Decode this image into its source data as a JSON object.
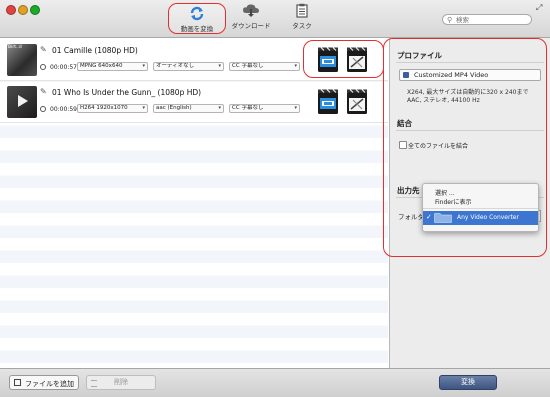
{
  "toolbar": {
    "convert_label": "動画を変換",
    "download_label": "ダウンロード",
    "task_label": "タスク",
    "search_placeholder": "検索"
  },
  "files": [
    {
      "name": "01 Camille (1080p HD)",
      "thumb_label": "Birt..d",
      "duration": "00:00:57",
      "video": "MPNG 640x640",
      "audio": "オーディオなし",
      "subtitle": "字幕なし"
    },
    {
      "name": "01 Who Is Under the Gunn_ (1080p HD)",
      "thumb_label": "",
      "duration": "00:00:59",
      "video": "H264 1920x1070",
      "audio": "aac (English)",
      "subtitle": "字幕なし"
    }
  ],
  "panel": {
    "profile_title": "プロファイル",
    "profile_button": "Customized MP4 Video",
    "profile_desc_1": "X264, 最大サイズは自動的に320 x 240まで",
    "profile_desc_2": "AAC, ステレオ, 44100 Hz",
    "merge_title": "結合",
    "merge_checkbox": "全てのファイルを結合",
    "output_title": "出力先",
    "folder_label": "フォルダ"
  },
  "folder_menu": {
    "item_select": "選択 ...",
    "item_finder": "Finderに表示",
    "item_selected": "Any Video Converter"
  },
  "bottom": {
    "add_label": "ファイルを追加",
    "delete_label": "削除",
    "convert_label": "変換"
  },
  "colors": {
    "highlight": "#e23030",
    "selection": "#3c76d0",
    "convert_button": "#3e5583"
  }
}
